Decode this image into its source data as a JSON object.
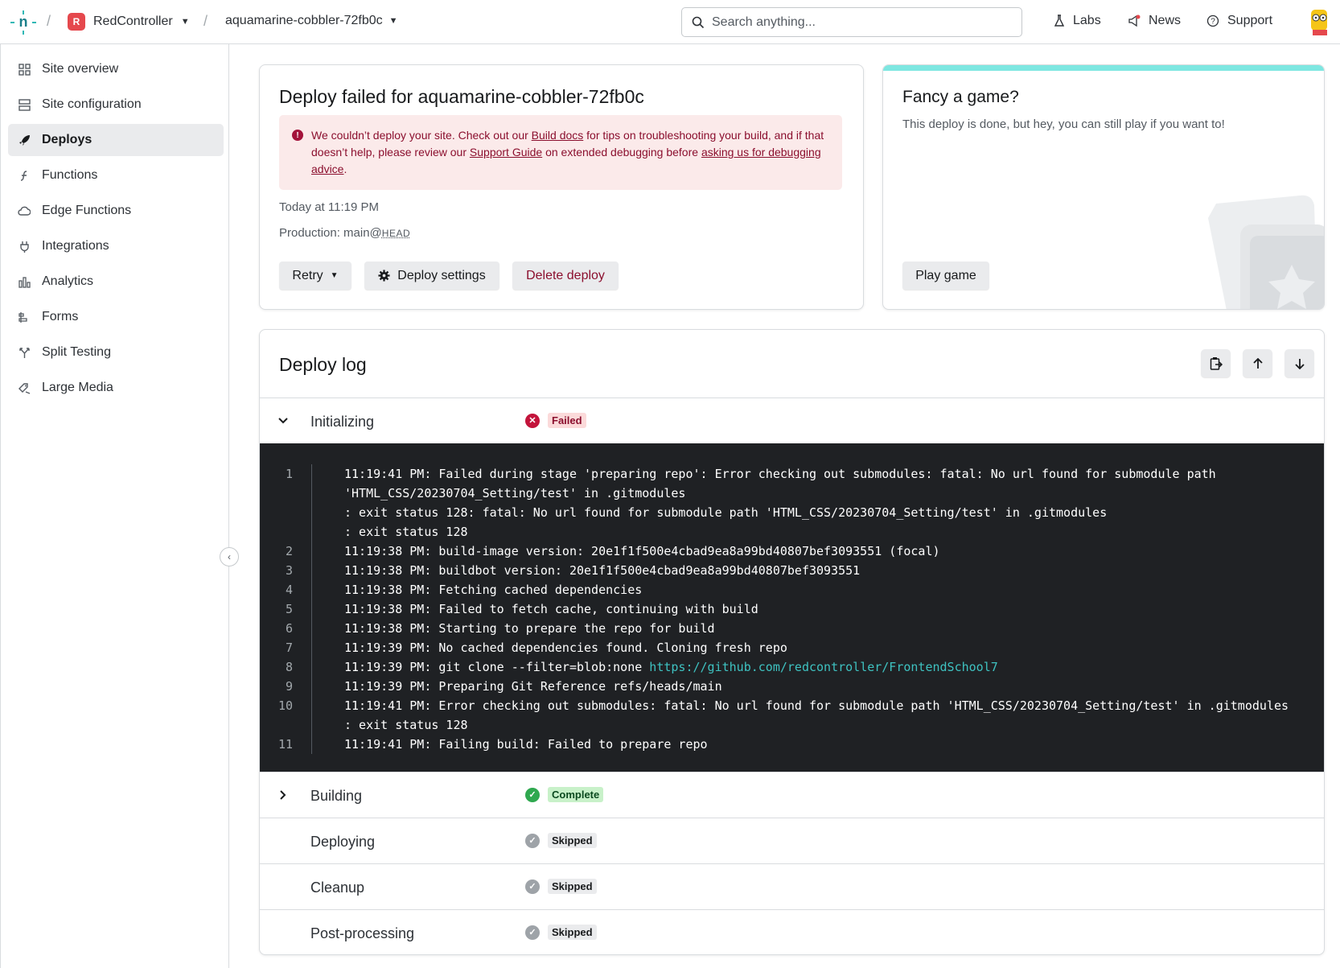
{
  "topbar": {
    "team_initial": "R",
    "team_name": "RedController",
    "site_name": "aquamarine-cobbler-72fb0c",
    "search_placeholder": "Search anything...",
    "labs": "Labs",
    "news": "News",
    "support": "Support"
  },
  "sidebar": {
    "items": [
      {
        "label": "Site overview",
        "icon": "grid-icon"
      },
      {
        "label": "Site configuration",
        "icon": "config-icon"
      },
      {
        "label": "Deploys",
        "icon": "rocket-icon",
        "active": true
      },
      {
        "label": "Functions",
        "icon": "function-icon"
      },
      {
        "label": "Edge Functions",
        "icon": "edge-function-icon"
      },
      {
        "label": "Integrations",
        "icon": "plug-icon"
      },
      {
        "label": "Analytics",
        "icon": "bar-chart-icon"
      },
      {
        "label": "Forms",
        "icon": "form-icon"
      },
      {
        "label": "Split Testing",
        "icon": "split-icon"
      },
      {
        "label": "Large Media",
        "icon": "media-icon"
      }
    ]
  },
  "deploy": {
    "title": "Deploy failed for aquamarine-cobbler-72fb0c",
    "alert": {
      "part1": "We couldn’t deploy your site. Check out our ",
      "link1": "Build docs",
      "part2": " for tips on troubleshooting your build, and if that doesn’t help, please review our ",
      "link2": "Support Guide",
      "part3": " on extended debugging before ",
      "link3": "asking us for debugging advice",
      "part4": "."
    },
    "time": "Today at 11:19 PM",
    "production_prefix": "Production: main@",
    "production_ref": "HEAD",
    "retry_label": "Retry",
    "settings_label": "Deploy settings",
    "delete_label": "Delete deploy"
  },
  "game": {
    "title": "Fancy a game?",
    "subtitle": "This deploy is done, but hey, you can still play if you want to!",
    "play_label": "Play game",
    "accent": "#7ee7e1"
  },
  "log": {
    "title": "Deploy log",
    "stages": [
      {
        "name": "Initializing",
        "status": "Failed",
        "expanded": true
      },
      {
        "name": "Building",
        "status": "Complete",
        "expanded": false
      },
      {
        "name": "Deploying",
        "status": "Skipped"
      },
      {
        "name": "Cleanup",
        "status": "Skipped"
      },
      {
        "name": "Post-processing",
        "status": "Skipped"
      }
    ],
    "lines": [
      {
        "n": "1",
        "rows": [
          "11:19:41 PM: Failed during stage 'preparing repo': Error checking out submodules: fatal: No url found for submodule path",
          "'HTML_CSS/20230704_Setting/test' in .gitmodules",
          ": exit status 128: fatal: No url found for submodule path 'HTML_CSS/20230704_Setting/test' in .gitmodules",
          ": exit status 128"
        ]
      },
      {
        "n": "2",
        "rows": [
          "11:19:38 PM: build-image version: 20e1f1f500e4cbad9ea8a99bd40807bef3093551 (focal)"
        ]
      },
      {
        "n": "3",
        "rows": [
          "11:19:38 PM: buildbot version: 20e1f1f500e4cbad9ea8a99bd40807bef3093551"
        ]
      },
      {
        "n": "4",
        "rows": [
          "11:19:38 PM: Fetching cached dependencies"
        ]
      },
      {
        "n": "5",
        "rows": [
          "11:19:38 PM: Failed to fetch cache, continuing with build"
        ]
      },
      {
        "n": "6",
        "rows": [
          "11:19:38 PM: Starting to prepare the repo for build"
        ]
      },
      {
        "n": "7",
        "rows": [
          "11:19:39 PM: No cached dependencies found. Cloning fresh repo"
        ]
      },
      {
        "n": "8",
        "rows": [
          "11:19:39 PM: git clone --filter=blob:none "
        ],
        "link": "https://github.com/redcontroller/FrontendSchool7"
      },
      {
        "n": "9",
        "rows": [
          "11:19:39 PM: Preparing Git Reference refs/heads/main"
        ]
      },
      {
        "n": "10",
        "rows": [
          "11:19:41 PM: Error checking out submodules: fatal: No url found for submodule path 'HTML_CSS/20230704_Setting/test' in .gitmodules",
          ": exit status 128"
        ]
      },
      {
        "n": "11",
        "rows": [
          "11:19:41 PM: Failing build: Failed to prepare repo"
        ]
      }
    ]
  },
  "colors": {
    "failed": "#c3143b",
    "failed_bg": "#fbdada",
    "complete": "#2fa84f",
    "complete_bg": "#c8f1c9",
    "skipped": "#9ea3a8",
    "skipped_bg": "#eaebed"
  }
}
